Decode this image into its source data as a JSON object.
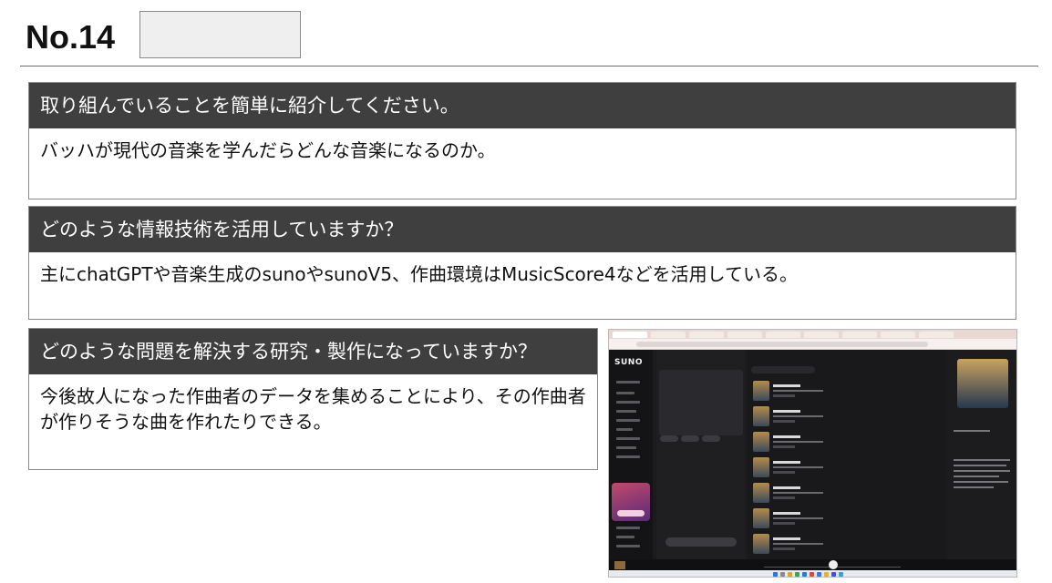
{
  "page": {
    "number_label": "No.14"
  },
  "sections": [
    {
      "question": "取り組んでいることを簡単に紹介してください。",
      "answer": "バッハが現代の音楽を学んだらどんな音楽になるのか。"
    },
    {
      "question": "どのような情報技術を活用していますか？",
      "answer": "主にchatGPTや音楽生成のsunoやsunoV5、作曲環境はMusicScore4などを活用している。"
    },
    {
      "question": "どのような問題を解決する研究・製作になっていますか？",
      "answer": "今後故人になった作曲者のデータを集めることにより、その作曲者が作りそうな曲を作れたりできる。"
    }
  ],
  "screenshot": {
    "logo": "SUNO"
  },
  "colors": {
    "question_bar": "#3f3f3f",
    "border": "#8a8a8a",
    "name_box": "#efefef"
  }
}
